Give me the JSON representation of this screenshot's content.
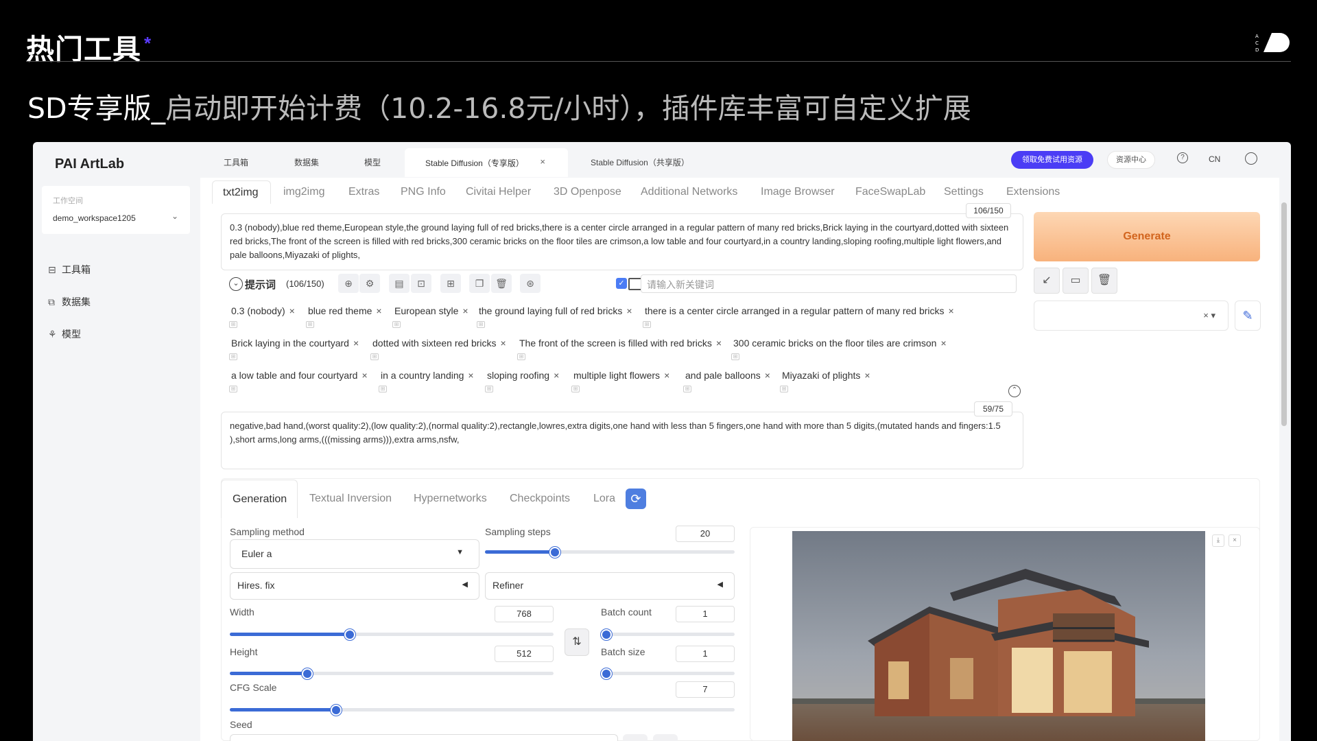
{
  "slide": {
    "title": "热门工具",
    "star": "*",
    "subtitle_main": "SD专享版_",
    "subtitle_rest": "启动即开始计费（10.2-16.8元/小时），插件库丰富可自定义扩展",
    "logo_letters": "A C D"
  },
  "app": {
    "brand": "PAI ArtLab",
    "workspace_label": "工作空间",
    "workspace_value": "demo_workspace1205",
    "sidebar": [
      {
        "label": "工具箱",
        "icon": "toolbox-icon"
      },
      {
        "label": "数据集",
        "icon": "dataset-icon"
      },
      {
        "label": "模型",
        "icon": "model-icon"
      }
    ],
    "topnav": [
      "工具箱",
      "数据集",
      "模型"
    ],
    "tabs": {
      "active": "Stable Diffusion（专享版）",
      "other": "Stable Diffusion（共享版）",
      "close": "×"
    },
    "free_trial": "领取免费试用资源",
    "resource_center": "资源中心",
    "lang": "CN",
    "help_icon": "?",
    "user_icon": "⚲"
  },
  "sd": {
    "tabs": [
      "txt2img",
      "img2img",
      "Extras",
      "PNG Info",
      "Civitai Helper",
      "3D Openpose",
      "Additional Networks",
      "Image Browser",
      "FaceSwapLab",
      "Settings",
      "Extensions"
    ],
    "prompt_counter": "106/150",
    "prompt": "0.3 (nobody),blue red theme,European style,the ground laying full of red bricks,there is a center circle arranged in a regular pattern of many red bricks,Brick laying in the courtyard,dotted with sixteen red bricks,The front of the screen is filled with red bricks,300 ceramic bricks on the floor tiles are crimson,a low table and four courtyard,in a country landing,sloping roofing,multiple light flowers,and pale balloons,Miyazaki of plights,",
    "toolbar_label": "提示词",
    "toolbar_count": "(106/150)",
    "keyword_placeholder": "请输入新关键词",
    "tag_rows": [
      [
        "0.3 (nobody)",
        "blue red theme",
        "European style",
        "the ground laying full of red bricks",
        "there is a center circle arranged in a regular pattern of many red bricks"
      ],
      [
        "Brick laying in the courtyard",
        "dotted with sixteen red bricks",
        "The front of the screen is filled with red bricks",
        "300 ceramic bricks on the floor tiles are crimson"
      ],
      [
        "a low table and four courtyard",
        "in a country landing",
        "sloping roofing",
        "multiple light flowers",
        "and pale balloons",
        "Miyazaki of plights"
      ]
    ],
    "tag_close": "×",
    "neg_counter": "59/75",
    "negative": "negative,bad hand,(worst quality:2),(low quality:2),(normal quality:2),rectangle,lowres,extra digits,one hand with less than 5 fingers,one hand with more than 5 digits,(mutated hands and fingers:1.5 ),short arms,long arms,(((missing arms))),extra arms,nsfw,",
    "generate": "Generate",
    "gen_tabs": [
      "Generation",
      "Textual Inversion",
      "Hypernetworks",
      "Checkpoints",
      "Lora"
    ],
    "sampling_method_label": "Sampling method",
    "sampling_method": "Euler a",
    "sampling_steps_label": "Sampling steps",
    "sampling_steps": "20",
    "hires": "Hires. fix",
    "refiner": "Refiner",
    "width_label": "Width",
    "width": "768",
    "height_label": "Height",
    "height": "512",
    "batch_count_label": "Batch count",
    "batch_count": "1",
    "batch_size_label": "Batch size",
    "batch_size": "1",
    "cfg_label": "CFG Scale",
    "cfg": "7",
    "seed_label": "Seed",
    "slider_levels": {
      "sampling_steps": 0.28,
      "width": 0.37,
      "height": 0.24,
      "batch_count": 0.0,
      "batch_size": 0.0,
      "cfg": 0.21
    }
  },
  "colors": {
    "accent": "#3b6bd6",
    "pill": "#4b3df5",
    "generate_text": "#d2651e",
    "star": "#5b3bff"
  }
}
